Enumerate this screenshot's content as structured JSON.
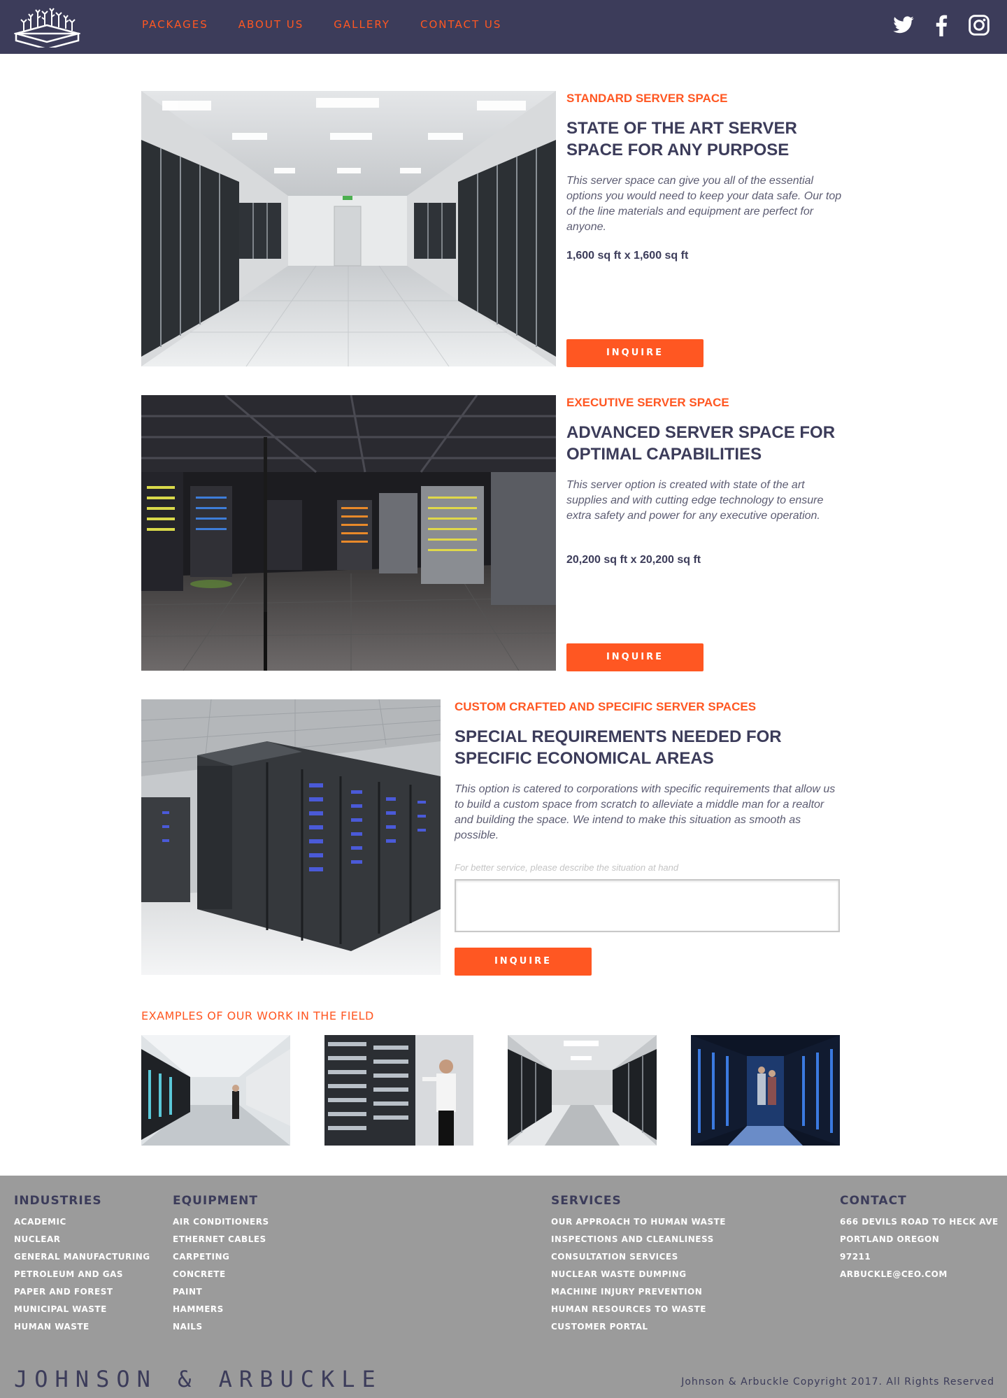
{
  "header": {
    "nav": [
      "PACKAGES",
      "ABOUT US",
      "GALLERY",
      "CONTACT US"
    ],
    "social": [
      "twitter-icon",
      "facebook-icon",
      "instagram-icon"
    ]
  },
  "packages": [
    {
      "kicker": "STANDARD SERVER SPACE",
      "title": "STATE OF THE ART SERVER SPACE FOR ANY PURPOSE",
      "description": "This server space can give you all of the essential options you would need to keep your data safe. Our top of the line materials and equipment are perfect for anyone.",
      "size": "1,600 sq ft x 1,600 sq ft",
      "button": "INQUIRE"
    },
    {
      "kicker": "EXECUTIVE SERVER SPACE",
      "title": "ADVANCED SERVER SPACE FOR OPTIMAL CAPABILITIES",
      "description": "This server option is created with state of the art supplies and with cutting edge technology to ensure extra safety and power for any executive operation.",
      "size": "20,200 sq ft x 20,200 sq ft",
      "button": "INQUIRE"
    },
    {
      "kicker": "CUSTOM CRAFTED AND SPECIFIC SERVER SPACES",
      "title": "SPECIAL REQUIREMENTS NEEDED FOR SPECIFIC ECONOMICAL AREAS",
      "description": "This option is catered to corporations with specific requirements that allow us to build a custom space from scratch to alleviate a middle man for a realtor and building the space. We intend to make this situation as smooth as possible.",
      "field_label": "For better service, please describe the situation at hand",
      "field_value": "",
      "button": "INQUIRE"
    }
  ],
  "examples": {
    "title": "EXAMPLES OF OUR WORK IN THE FIELD"
  },
  "footer": {
    "columns": [
      {
        "heading": "INDUSTRIES",
        "items": [
          "ACADEMIC",
          "NUCLEAR",
          "GENERAL MANUFACTURING",
          "PETROLEUM AND GAS",
          "PAPER AND FOREST",
          "MUNICIPAL WASTE",
          "HUMAN WASTE"
        ]
      },
      {
        "heading": "EQUIPMENT",
        "items": [
          "AIR CONDITIONERS",
          "ETHERNET CABLES",
          "CARPETING",
          "CONCRETE",
          "PAINT",
          "HAMMERS",
          "NAILS"
        ]
      },
      {
        "heading": "SERVICES",
        "items": [
          "OUR APPROACH TO HUMAN WASTE",
          "INSPECTIONS AND CLEANLINESS",
          "CONSULTATION SERVICES",
          "NUCLEAR WASTE DUMPING",
          "MACHINE INJURY PREVENTION",
          "HUMAN RESOURCES TO WASTE",
          "CUSTOMER PORTAL"
        ]
      },
      {
        "heading": "CONTACT",
        "items": [
          "666 DEVILS ROAD TO HECK AVE",
          "PORTLAND OREGON",
          "97211",
          "ARBUCKLE@CEO.COM"
        ]
      }
    ],
    "brand": "JOHNSON & ARBUCKLE",
    "copyright": "Johnson & Arbuckle Copyright 2017. All Rights Reserved"
  },
  "colors": {
    "header_bg": "#3c3c5a",
    "accent": "#ff5722",
    "footer_bg": "#9b9b9b",
    "heading_text": "#3c3c5a"
  }
}
